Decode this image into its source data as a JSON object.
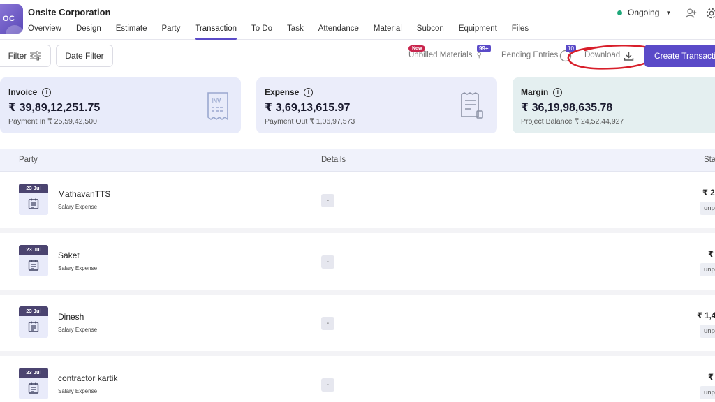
{
  "header": {
    "logo_text": "OC",
    "company": "Onsite Corporation",
    "status": "Ongoing",
    "tabs": [
      {
        "label": "Overview"
      },
      {
        "label": "Design"
      },
      {
        "label": "Estimate"
      },
      {
        "label": "Party"
      },
      {
        "label": "Transaction",
        "active": true
      },
      {
        "label": "To Do"
      },
      {
        "label": "Task"
      },
      {
        "label": "Attendance"
      },
      {
        "label": "Material"
      },
      {
        "label": "Subcon"
      },
      {
        "label": "Equipment"
      },
      {
        "label": "Files"
      }
    ],
    "icons": [
      "add-user-icon",
      "gear-icon"
    ]
  },
  "toolbar": {
    "filter_label": "Filter",
    "date_filter_label": "Date Filter",
    "unbilled_label": "Unbilled Materials",
    "new_badge": "New",
    "unbilled_count": "99+",
    "pending_label": "Pending Entries",
    "pending_count": "10",
    "download_label": "Download",
    "create_label": "Create Transaction"
  },
  "cards": {
    "invoice": {
      "title": "Invoice",
      "amount": "₹ 39,89,12,251.75",
      "sub": "Payment In ₹ 25,59,42,500",
      "icon": "invoice-icon",
      "icon_text": "INV"
    },
    "expense": {
      "title": "Expense",
      "amount": "₹ 3,69,13,615.97",
      "sub": "Payment Out ₹ 1,06,97,573",
      "icon": "receipt-icon"
    },
    "margin": {
      "title": "Margin",
      "amount": "₹ 36,19,98,635.78",
      "sub": "Project Balance ₹ 24,52,44,927"
    }
  },
  "table": {
    "headers": {
      "party": "Party",
      "details": "Details",
      "status": "Sta"
    },
    "rows": [
      {
        "date": "23 Jul",
        "name": "MathavanTTS",
        "type": "Salary Expense",
        "details": "-",
        "amount": "₹ 2,",
        "status": "unp"
      },
      {
        "date": "23 Jul",
        "name": "Saket",
        "type": "Salary Expense",
        "details": "-",
        "amount": "₹",
        "status": "unp"
      },
      {
        "date": "23 Jul",
        "name": "Dinesh",
        "type": "Salary Expense",
        "details": "-",
        "amount": "₹ 1,4",
        "status": "unp"
      },
      {
        "date": "23 Jul",
        "name": "contractor kartik",
        "type": "Salary Expense",
        "details": "-",
        "amount": "₹",
        "status": "unp"
      }
    ]
  },
  "colors": {
    "accent": "#5a4ac8",
    "status_green": "#1fa87a",
    "new_badge": "#c9254d",
    "annotation": "#d81e2a"
  }
}
